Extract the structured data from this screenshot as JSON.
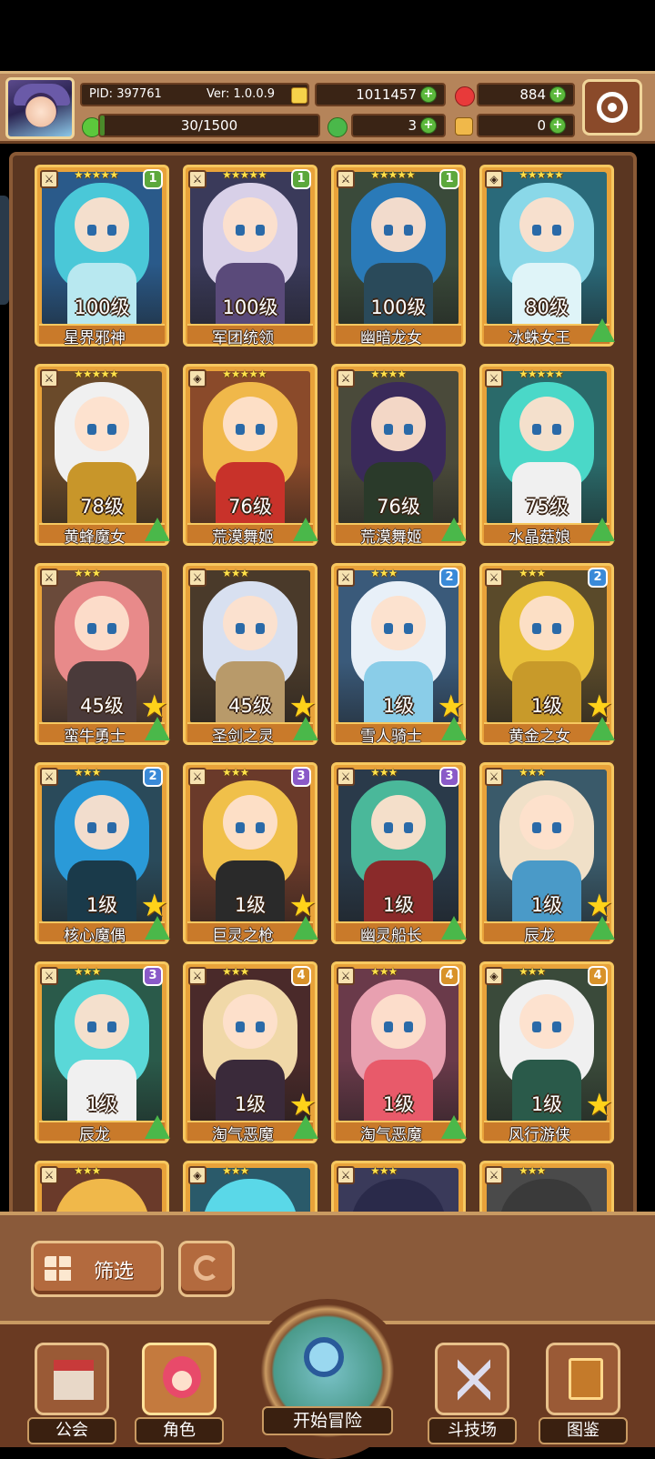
{
  "header": {
    "pid": "PID: 397761",
    "version": "Ver: 1.0.0.9",
    "gold": "1011457",
    "gems": "884",
    "stamina": "30/1500",
    "stamina_fraction": 0.02,
    "clover": "3",
    "key": "0"
  },
  "colors": {
    "panel_bg": "#5a3621",
    "card_frame": "#e8a23a",
    "upgrade_green": "#4ab84a",
    "star_yellow": "#ffd21a"
  },
  "cards": [
    {
      "level": "100级",
      "name": "星界邪神",
      "stars": "★★★★★",
      "rank": "1",
      "rank_class": "r1",
      "icon": "sword-icon",
      "hair": "#4ac8d8",
      "outfit": "#b8e8f0",
      "bg": "#2a5a8a",
      "bigstar": false,
      "up": false
    },
    {
      "level": "100级",
      "name": "军团统领",
      "stars": "★★★★★",
      "rank": "1",
      "rank_class": "r1",
      "icon": "sword-icon",
      "hair": "#d8d0e8",
      "outfit": "#5a4a7a",
      "bg": "#3a3a5a",
      "bigstar": false,
      "up": false
    },
    {
      "level": "100级",
      "name": "幽暗龙女",
      "stars": "★★★★★",
      "rank": "1",
      "rank_class": "r1",
      "icon": "sword-icon",
      "hair": "#2a7ab8",
      "outfit": "#2a4a5a",
      "bg": "#3a4a3a",
      "bigstar": false,
      "up": false
    },
    {
      "level": "80级",
      "name": "冰蛛女王",
      "stars": "★★★★★",
      "rank": "",
      "rank_class": "",
      "icon": "shield-icon",
      "hair": "#8ad8e8",
      "outfit": "#dff4f8",
      "bg": "#2a6a7a",
      "bigstar": false,
      "up": true
    },
    {
      "level": "78级",
      "name": "黄蜂魔女",
      "stars": "★★★★★",
      "rank": "",
      "rank_class": "",
      "icon": "sword-icon",
      "hair": "#f0f0f0",
      "outfit": "#c8962a",
      "bg": "#6a4a2a",
      "bigstar": false,
      "up": true
    },
    {
      "level": "76级",
      "name": "荒漠舞姬",
      "stars": "★★★★★",
      "rank": "",
      "rank_class": "",
      "icon": "shield-icon",
      "hair": "#f0b84a",
      "outfit": "#c8322a",
      "bg": "#8a4a2a",
      "bigstar": false,
      "up": true
    },
    {
      "level": "76级",
      "name": "荒漠舞姬",
      "stars": "★★★★",
      "rank": "",
      "rank_class": "",
      "icon": "sword-icon",
      "hair": "#3a2a5a",
      "outfit": "#2a3a2a",
      "bg": "#4a4a3a",
      "bigstar": false,
      "up": true
    },
    {
      "level": "75级",
      "name": "水晶菇娘",
      "stars": "★★★★★",
      "rank": "",
      "rank_class": "",
      "icon": "sword-icon",
      "hair": "#4ad8c8",
      "outfit": "#f0f0f0",
      "bg": "#2a6a6a",
      "bigstar": false,
      "up": true
    },
    {
      "level": "45级",
      "name": "蛮牛勇士",
      "stars": "★★★",
      "rank": "",
      "rank_class": "",
      "icon": "sword-icon",
      "hair": "#e88a8a",
      "outfit": "#4a3a3a",
      "bg": "#6a4a3a",
      "bigstar": true,
      "up": true
    },
    {
      "level": "45级",
      "name": "圣剑之灵",
      "stars": "★★★",
      "rank": "",
      "rank_class": "",
      "icon": "sword-icon",
      "hair": "#d8e0f0",
      "outfit": "#b89a6a",
      "bg": "#4a3a2a",
      "bigstar": true,
      "up": true
    },
    {
      "level": "1级",
      "name": "雪人骑士",
      "stars": "★★★",
      "rank": "2",
      "rank_class": "r2",
      "icon": "sword-icon",
      "hair": "#e8f0f8",
      "outfit": "#8acde8",
      "bg": "#3a5a7a",
      "bigstar": true,
      "up": true
    },
    {
      "level": "1级",
      "name": "黄金之女",
      "stars": "★★★",
      "rank": "2",
      "rank_class": "r2",
      "icon": "sword-icon",
      "hair": "#e8c03a",
      "outfit": "#c89a2a",
      "bg": "#5a4a2a",
      "bigstar": true,
      "up": true
    },
    {
      "level": "1级",
      "name": "核心魔偶",
      "stars": "★★★",
      "rank": "2",
      "rank_class": "r2",
      "icon": "sword-icon",
      "hair": "#2a9ad8",
      "outfit": "#1a3a4a",
      "bg": "#2a4a5a",
      "bigstar": true,
      "up": true
    },
    {
      "level": "1级",
      "name": "巨灵之枪",
      "stars": "★★★",
      "rank": "3",
      "rank_class": "r3",
      "icon": "sword-icon",
      "hair": "#f0c04a",
      "outfit": "#2a2a2a",
      "bg": "#6a3a2a",
      "bigstar": true,
      "up": true
    },
    {
      "level": "1级",
      "name": "幽灵船长",
      "stars": "★★★",
      "rank": "3",
      "rank_class": "r3",
      "icon": "sword-icon",
      "hair": "#4ab89a",
      "outfit": "#8a2a2a",
      "bg": "#2a3a4a",
      "bigstar": false,
      "up": true
    },
    {
      "level": "1级",
      "name": "辰龙",
      "stars": "★★★",
      "rank": "",
      "rank_class": "",
      "icon": "sword-icon",
      "hair": "#f0e0c8",
      "outfit": "#4a9ac8",
      "bg": "#3a5a6a",
      "bigstar": true,
      "up": true
    },
    {
      "level": "1级",
      "name": "辰龙",
      "stars": "★★★",
      "rank": "3",
      "rank_class": "r3",
      "icon": "sword-icon",
      "hair": "#5ad8d8",
      "outfit": "#f0f0f0",
      "bg": "#2a5a4a",
      "bigstar": false,
      "up": true
    },
    {
      "level": "1级",
      "name": "淘气恶魔",
      "stars": "★★★",
      "rank": "4",
      "rank_class": "r4",
      "icon": "sword-icon",
      "hair": "#f0d8a8",
      "outfit": "#3a2a3a",
      "bg": "#4a2a2a",
      "bigstar": true,
      "up": true
    },
    {
      "level": "1级",
      "name": "淘气恶魔",
      "stars": "★★★",
      "rank": "4",
      "rank_class": "r4",
      "icon": "sword-icon",
      "hair": "#e8a0b0",
      "outfit": "#e85a6a",
      "bg": "#6a3a4a",
      "bigstar": false,
      "up": true
    },
    {
      "level": "1级",
      "name": "风行游侠",
      "stars": "★★★",
      "rank": "4",
      "rank_class": "r4",
      "icon": "shield-icon",
      "hair": "#f0f0f0",
      "outfit": "#2a5a4a",
      "bg": "#3a4a3a",
      "bigstar": true,
      "up": false
    }
  ],
  "partial_cards": [
    {
      "stars": "★★★",
      "icon": "sword-icon",
      "hair": "#f0b84a",
      "bg": "#6a3a2a"
    },
    {
      "stars": "★★★",
      "icon": "shield-icon",
      "hair": "#5ad8e8",
      "bg": "#2a5a6a"
    },
    {
      "stars": "★★★",
      "icon": "sword-icon",
      "hair": "#2a2a4a",
      "bg": "#3a3a5a"
    },
    {
      "stars": "★★★",
      "icon": "sword-icon",
      "hair": "#3a3a3a",
      "bg": "#4a4a4a"
    }
  ],
  "toolbar": {
    "filter_label": "筛选"
  },
  "nav": {
    "guild": "公会",
    "characters": "角色",
    "adventure": "开始冒险",
    "arena": "斗技场",
    "codex": "图鉴",
    "active": "characters"
  }
}
